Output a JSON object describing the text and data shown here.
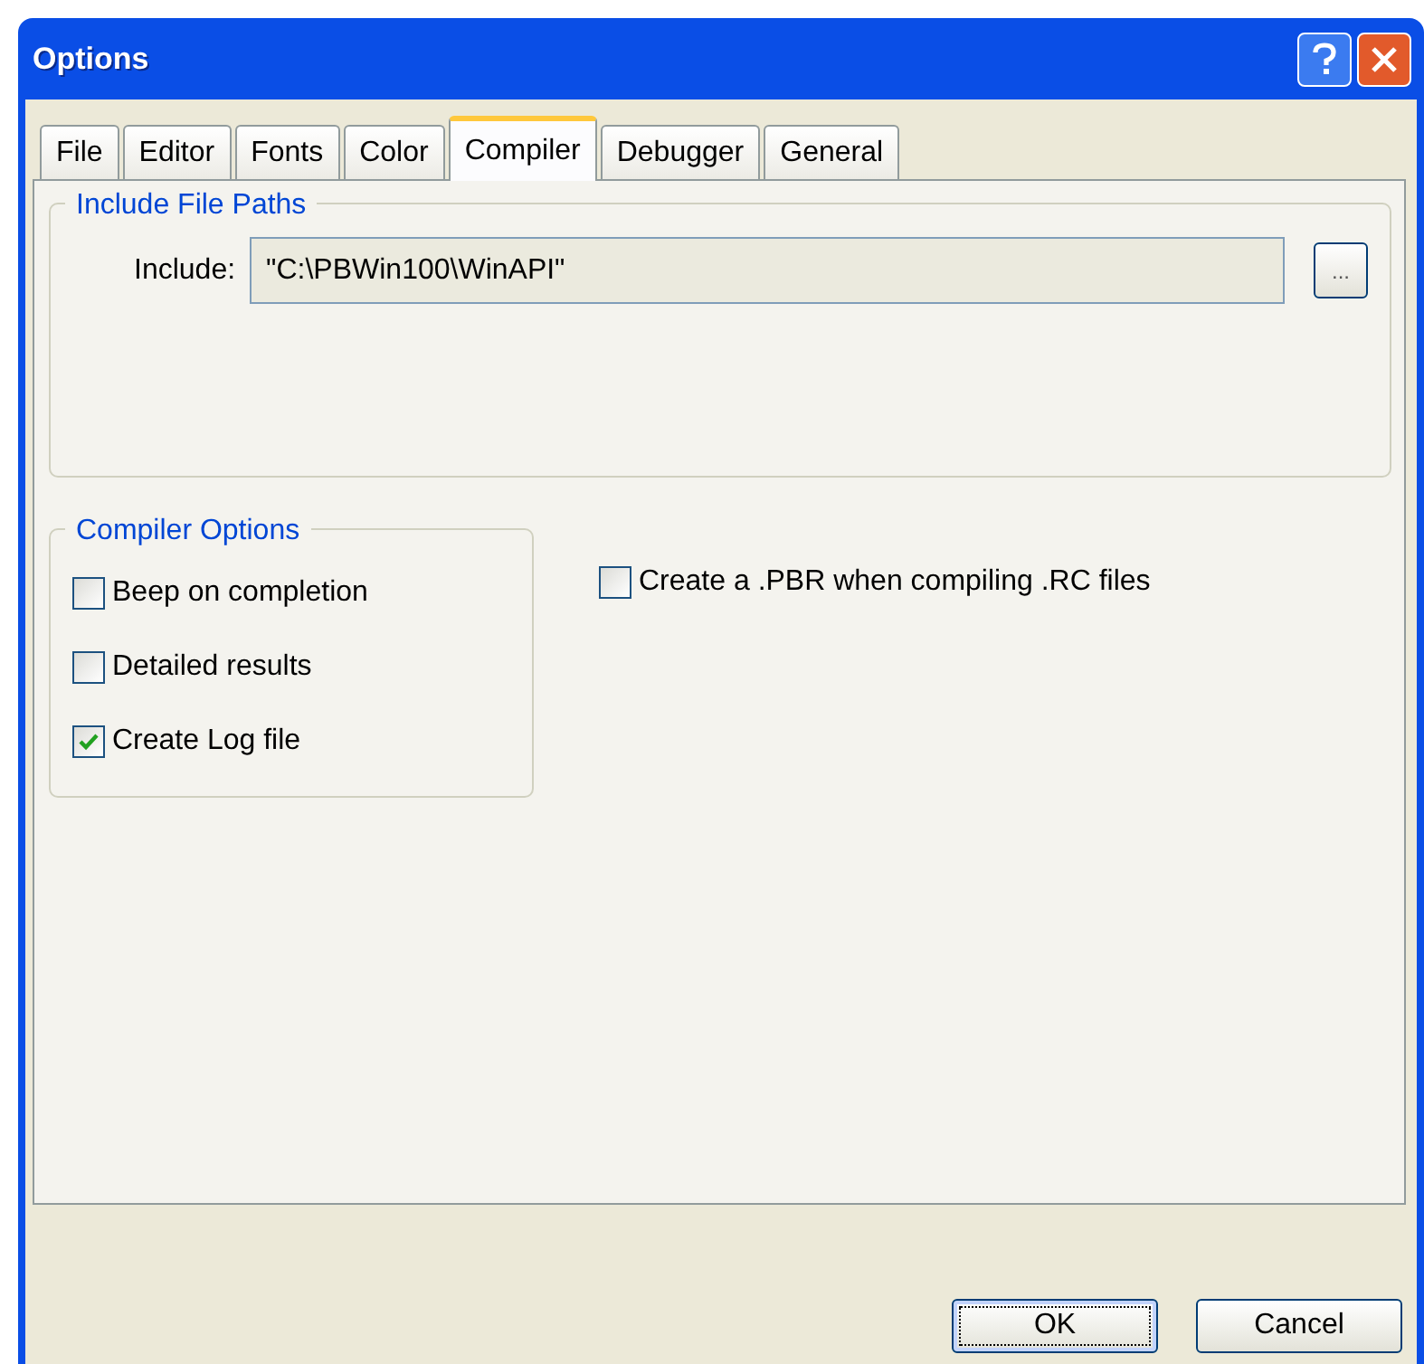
{
  "window": {
    "title": "Options"
  },
  "tabs": [
    {
      "label": "File",
      "selected": false
    },
    {
      "label": "Editor",
      "selected": false
    },
    {
      "label": "Fonts",
      "selected": false
    },
    {
      "label": "Color",
      "selected": false
    },
    {
      "label": "Compiler",
      "selected": true
    },
    {
      "label": "Debugger",
      "selected": false
    },
    {
      "label": "General",
      "selected": false
    }
  ],
  "include_group": {
    "title": "Include File Paths",
    "label": "Include:",
    "value": "\"C:\\PBWin100\\WinAPI\"",
    "browse_button": "..."
  },
  "compiler_options": {
    "title": "Compiler Options",
    "checkboxes": [
      {
        "label": "Beep on completion",
        "checked": false
      },
      {
        "label": "Detailed results",
        "checked": false
      },
      {
        "label": "Create Log file",
        "checked": true
      }
    ]
  },
  "side_options": [
    {
      "label": "Create a .PBR when compiling .RC files",
      "checked": false
    }
  ],
  "buttons": [
    {
      "label": "OK",
      "focused": true
    },
    {
      "label": "Cancel",
      "focused": false
    }
  ]
}
